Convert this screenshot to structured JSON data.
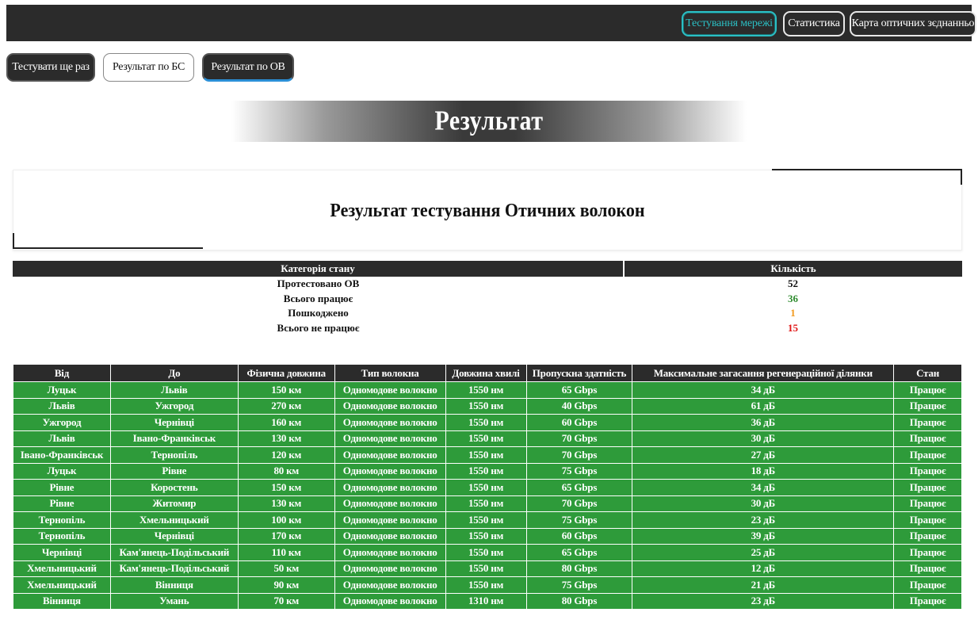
{
  "nav": {
    "network_testing": "Тестування мережі",
    "statistics": "Статистика",
    "fiber_map": "Карта оптичних зєднанньо"
  },
  "actions": {
    "retest": "Тестувати ще раз",
    "result_bs": "Результат по БС",
    "result_ov": "Результат по ОВ"
  },
  "banner": {
    "title": "Результат"
  },
  "result_box": {
    "title": "Результат тестування Отичних волокон"
  },
  "summary": {
    "headers": [
      "Категорія стану",
      "Кількість"
    ],
    "rows": [
      {
        "label": "Протестовано ОВ",
        "value": "52"
      },
      {
        "label": "Всього працює",
        "value": "36"
      },
      {
        "label": "Пошкоджено",
        "value": "1"
      },
      {
        "label": "Всього не працює",
        "value": "15"
      }
    ]
  },
  "fibers": {
    "headers": [
      "Від",
      "До",
      "Фізична довжина",
      "Тип волокна",
      "Довжина хвилі",
      "Пропускна здатність",
      "Максимальне загасання регенераційної ділянки",
      "Стан"
    ],
    "rows": [
      [
        "Луцьк",
        "Львів",
        "150 км",
        "Одномодове волокно",
        "1550 нм",
        "65 Gbps",
        "34 дБ",
        "Працює"
      ],
      [
        "Львів",
        "Ужгород",
        "270 км",
        "Одномодове волокно",
        "1550 нм",
        "40 Gbps",
        "61 дБ",
        "Працює"
      ],
      [
        "Ужгород",
        "Чернівці",
        "160 км",
        "Одномодове волокно",
        "1550 нм",
        "60 Gbps",
        "36 дБ",
        "Працює"
      ],
      [
        "Львів",
        "Івано-Франківськ",
        "130 км",
        "Одномодове волокно",
        "1550 нм",
        "70 Gbps",
        "30 дБ",
        "Працює"
      ],
      [
        "Івано-Франківськ",
        "Тернопіль",
        "120 км",
        "Одномодове волокно",
        "1550 нм",
        "70 Gbps",
        "27 дБ",
        "Працює"
      ],
      [
        "Луцьк",
        "Рівне",
        "80 км",
        "Одномодове волокно",
        "1550 нм",
        "75 Gbps",
        "18 дБ",
        "Працює"
      ],
      [
        "Рівне",
        "Коростень",
        "150 км",
        "Одномодове волокно",
        "1550 нм",
        "65 Gbps",
        "34 дБ",
        "Працює"
      ],
      [
        "Рівне",
        "Житомир",
        "130 км",
        "Одномодове волокно",
        "1550 нм",
        "70 Gbps",
        "30 дБ",
        "Працює"
      ],
      [
        "Тернопіль",
        "Хмельницький",
        "100 км",
        "Одномодове волокно",
        "1550 нм",
        "75 Gbps",
        "23 дБ",
        "Працює"
      ],
      [
        "Тернопіль",
        "Чернівці",
        "170 км",
        "Одномодове волокно",
        "1550 нм",
        "60 Gbps",
        "39 дБ",
        "Працює"
      ],
      [
        "Чернівці",
        "Кам'янець-Подільський",
        "110 км",
        "Одномодове волокно",
        "1550 нм",
        "65 Gbps",
        "25 дБ",
        "Працює"
      ],
      [
        "Хмельницький",
        "Кам'янець-Подільський",
        "50 км",
        "Одномодове волокно",
        "1550 нм",
        "80 Gbps",
        "12 дБ",
        "Працює"
      ],
      [
        "Хмельницький",
        "Вінниця",
        "90 км",
        "Одномодове волокно",
        "1550 нм",
        "75 Gbps",
        "21 дБ",
        "Працює"
      ],
      [
        "Вінниця",
        "Умань",
        "70 км",
        "Одномодове волокно",
        "1310 нм",
        "80 Gbps",
        "23 дБ",
        "Працює"
      ]
    ]
  },
  "colors": {
    "topbar": "#2b2b2b",
    "active_nav": "#2bbfc4",
    "row_ok": "#2e9b3a",
    "value_working": "#2e8b2e",
    "value_damaged": "#f29a1f",
    "value_not_working": "#e01414"
  }
}
